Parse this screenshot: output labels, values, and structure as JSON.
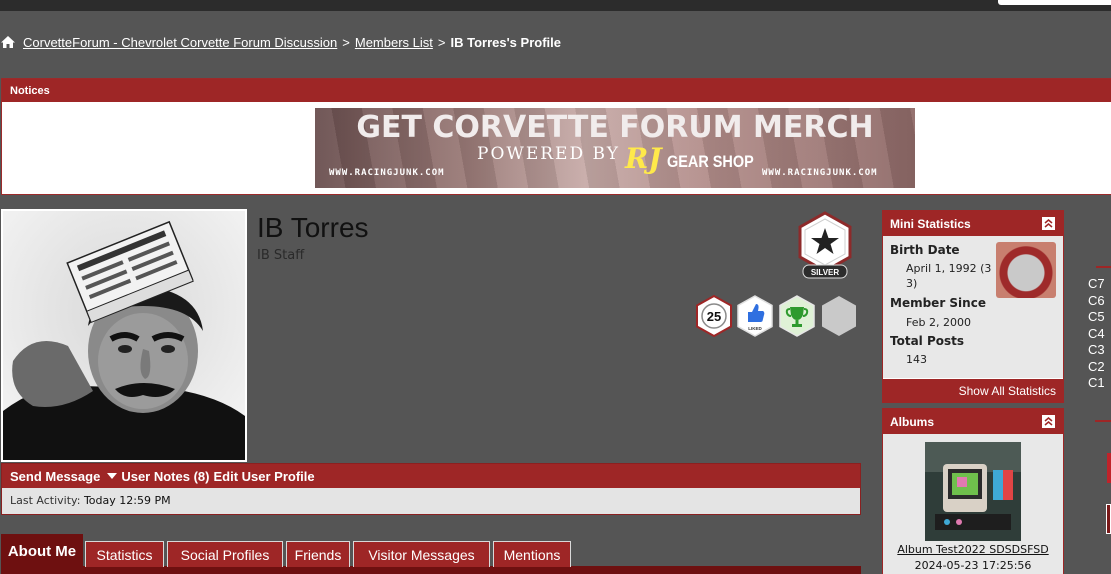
{
  "breadcrumb": {
    "items": [
      "CorvetteForum - Chevrolet Corvette Forum Discussion",
      "Members List"
    ],
    "separator": ">",
    "current": "IB Torres's Profile"
  },
  "notices": {
    "title": "Notices",
    "banner": {
      "headline": "GET CORVETTE FORUM MERCH",
      "powered_by": "POWERED BY",
      "brand": "RJ",
      "shop": "GEAR SHOP",
      "url_left": "WWW.RACINGJUNK.COM",
      "url_right": "WWW.RACINGJUNK.COM"
    }
  },
  "profile": {
    "name": "IB Torres",
    "user_title": "IB Staff",
    "rank_label": "SILVER",
    "achievement_count": "25",
    "liked_label": "LIKED"
  },
  "actions": {
    "send_message": "Send Message",
    "user_notes": "User Notes (8)",
    "edit_profile": "Edit User Profile",
    "last_activity_label": "Last Activity:",
    "last_activity_value": "Today 12:59 PM"
  },
  "tabs": [
    {
      "label": "About Me",
      "active": true
    },
    {
      "label": "Statistics",
      "active": false
    },
    {
      "label": "Social Profiles",
      "active": false
    },
    {
      "label": "Friends",
      "active": false
    },
    {
      "label": "Visitor Messages",
      "active": false
    },
    {
      "label": "Mentions",
      "active": false
    }
  ],
  "mini_statistics": {
    "title": "Mini Statistics",
    "birth_date_label": "Birth Date",
    "birth_date_value": "April 1, 1992 (3",
    "birth_date_value2": "3)",
    "member_since_label": "Member Since",
    "member_since_value": "Feb 2, 2000",
    "total_posts_label": "Total Posts",
    "total_posts_value": "143",
    "show_all": "Show All Statistics"
  },
  "albums": {
    "title": "Albums",
    "album_title": "Album Test2022 SDSDSFSD",
    "album_date": "2024-05-23 17:25:56"
  },
  "generations": [
    "C7",
    "C6",
    "C5",
    "C4",
    "C3",
    "C2",
    "C1"
  ],
  "colors": {
    "page_bg": "#555555",
    "accent_red": "#9e2626",
    "dark_red": "#6e1010"
  }
}
